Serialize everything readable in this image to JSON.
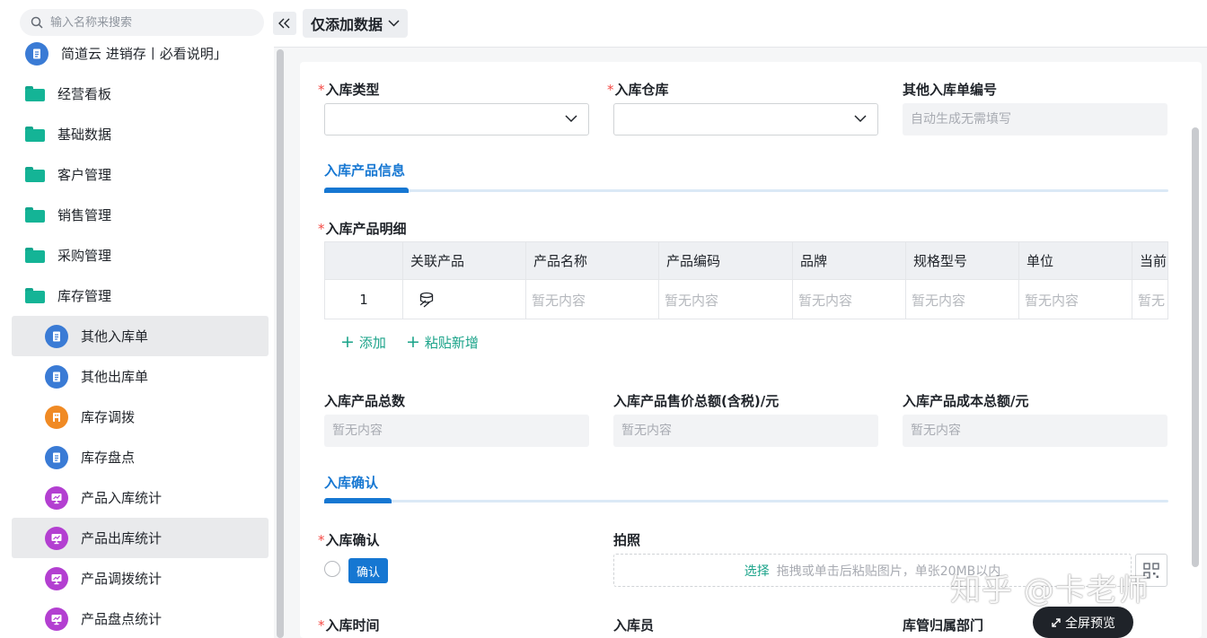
{
  "search": {
    "placeholder": "输入名称来搜索"
  },
  "sidebar": {
    "items": [
      {
        "label": "简道云 进销存丨必看说明」",
        "icon": "document-icon",
        "level": "top",
        "color": "#3a7bd5"
      },
      {
        "label": "经营看板",
        "icon": "folder-icon",
        "level": "top"
      },
      {
        "label": "基础数据",
        "icon": "folder-icon",
        "level": "top"
      },
      {
        "label": "客户管理",
        "icon": "folder-icon",
        "level": "top"
      },
      {
        "label": "销售管理",
        "icon": "folder-icon",
        "level": "top"
      },
      {
        "label": "采购管理",
        "icon": "folder-icon",
        "level": "top"
      },
      {
        "label": "库存管理",
        "icon": "folder-open-icon",
        "level": "top"
      },
      {
        "label": "其他入库单",
        "icon": "document-icon",
        "level": "sub",
        "color": "#3a7bd5",
        "active": true
      },
      {
        "label": "其他出库单",
        "icon": "document-icon",
        "level": "sub",
        "color": "#3a7bd5"
      },
      {
        "label": "库存调拨",
        "icon": "building-icon",
        "level": "sub",
        "color": "#f08a24"
      },
      {
        "label": "库存盘点",
        "icon": "document-icon",
        "level": "sub",
        "color": "#3a7bd5"
      },
      {
        "label": "产品入库统计",
        "icon": "chart-screen-icon",
        "level": "sub",
        "color": "#b33fd1"
      },
      {
        "label": "产品出库统计",
        "icon": "chart-screen-icon",
        "level": "sub",
        "color": "#b33fd1",
        "hover": true
      },
      {
        "label": "产品调拨统计",
        "icon": "chart-screen-icon",
        "level": "sub",
        "color": "#b33fd1"
      },
      {
        "label": "产品盘点统计",
        "icon": "chart-screen-icon",
        "level": "sub",
        "color": "#b33fd1"
      }
    ]
  },
  "topbar": {
    "mode_label": "仅添加数据"
  },
  "form": {
    "required_mark": "*",
    "type_label": "入库类型",
    "warehouse_label": "入库仓库",
    "other_no_label": "其他入库单编号",
    "other_no_placeholder": "自动生成无需填写",
    "section_product": "入库产品信息",
    "detail_label": "入库产品明细",
    "table": {
      "headers": [
        "",
        "关联产品",
        "产品名称",
        "产品编码",
        "品牌",
        "规格型号",
        "单位",
        "当前"
      ],
      "row_index": "1",
      "empty": "暂无内容",
      "empty_last": "暂无"
    },
    "add_label": "添加",
    "paste_label": "粘贴新增",
    "total_qty_label": "入库产品总数",
    "total_price_label": "入库产品售价总额(含税)/元",
    "total_cost_label": "入库产品成本总额/元",
    "empty_value": "暂无内容",
    "section_confirm": "入库确认",
    "confirm_label": "入库确认",
    "confirm_tag": "确认",
    "photo_label": "拍照",
    "upload_select": "选择",
    "upload_hint": "拖拽或单击后粘贴图片，单张20MB以内",
    "time_label": "入库时间",
    "staff_label": "入库员",
    "dept_label": "库管归属部门"
  },
  "watermark": "知乎 @卡老师",
  "fullscreen_label": "全屏预览",
  "colors": {
    "accent": "#1677d2",
    "teal": "#1aa389",
    "required": "#f54a45"
  }
}
